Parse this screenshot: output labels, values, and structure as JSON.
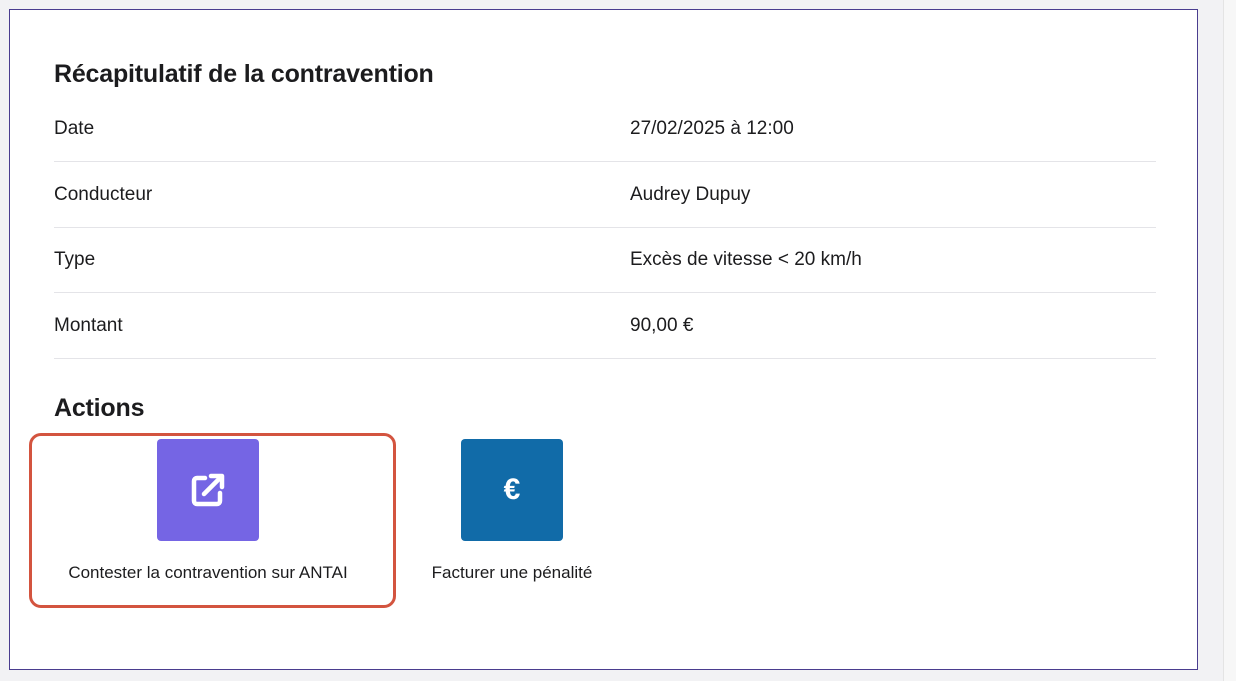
{
  "summary": {
    "title": "Récapitulatif de la contravention",
    "rows": [
      {
        "label": "Date",
        "value": "27/02/2025 à 12:00"
      },
      {
        "label": "Conducteur",
        "value": "Audrey Dupuy"
      },
      {
        "label": "Type",
        "value": "Excès de vitesse < 20 km/h"
      },
      {
        "label": "Montant",
        "value": "90,00 €"
      }
    ]
  },
  "actions": {
    "title": "Actions",
    "items": [
      {
        "label": "Contester la contravention sur ANTAI",
        "icon": "external-link-icon",
        "color": "#7565e4"
      },
      {
        "label": "Facturer une pénalité",
        "icon": "euro-icon",
        "symbol": "€",
        "color": "#116ba8"
      }
    ]
  },
  "colors": {
    "panel_border": "#4a3d8f",
    "highlight": "#d3543f"
  }
}
